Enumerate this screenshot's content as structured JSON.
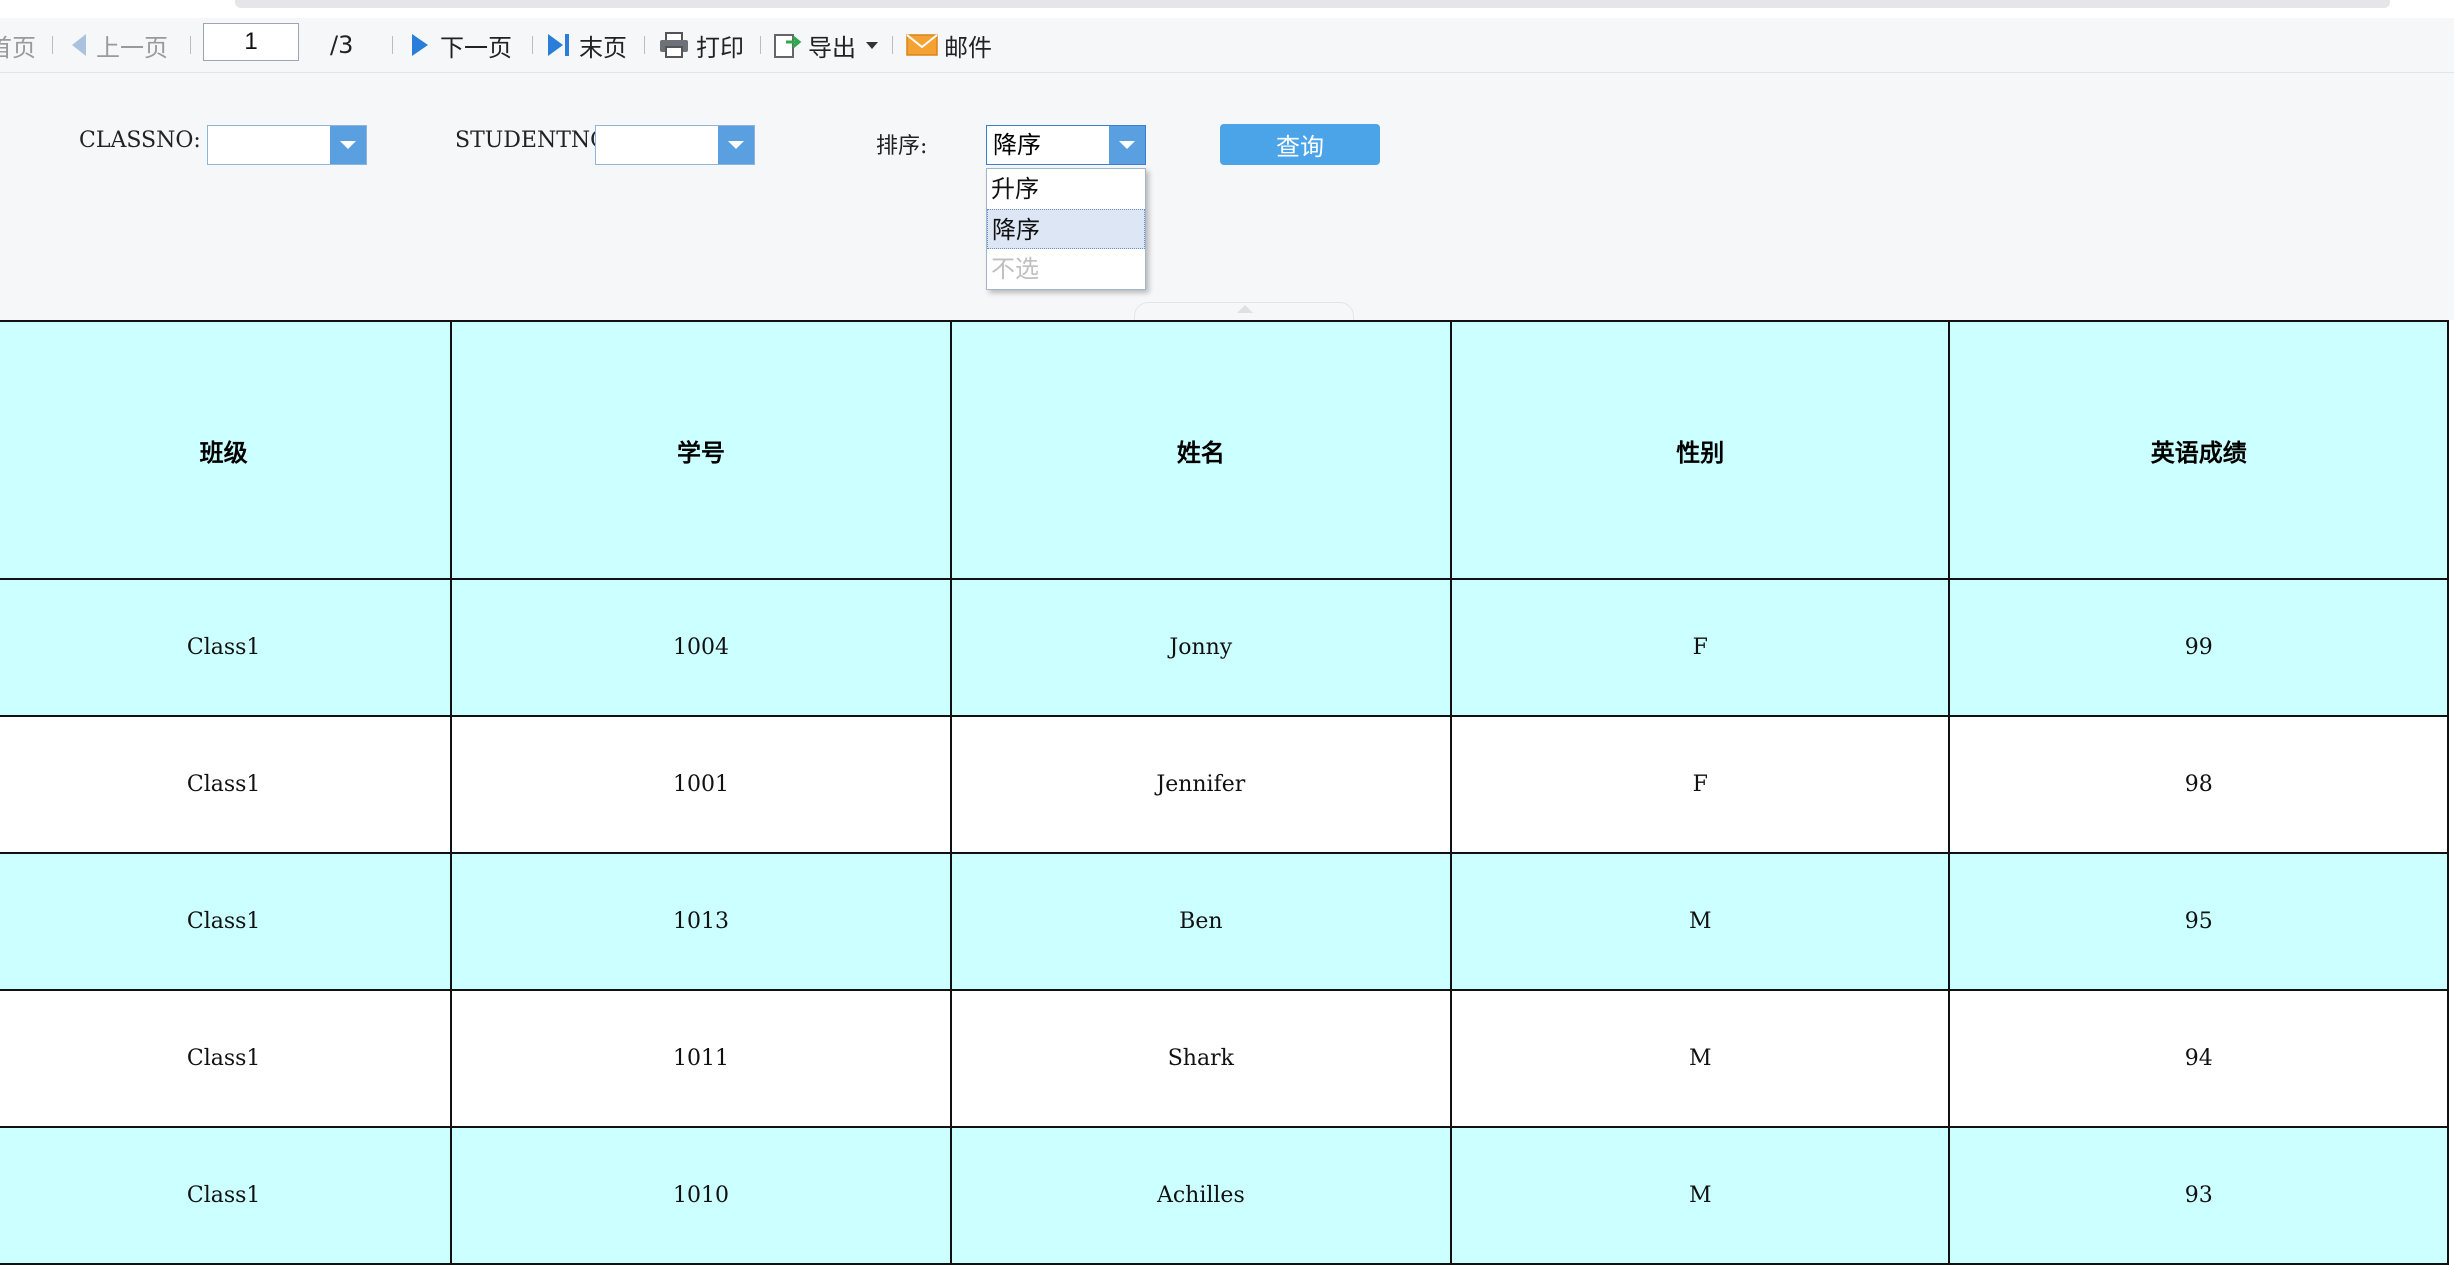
{
  "toolbar": {
    "first_label": "首页",
    "prev_label": "上一页",
    "page_input": "1",
    "total_pages": "/3",
    "next_label": "下一页",
    "last_label": "末页",
    "print_label": "打印",
    "export_label": "导出",
    "mail_label": "邮件"
  },
  "params": {
    "classno_label": "CLASSNO:",
    "classno_value": "",
    "studentno_label": "STUDENTNO:",
    "studentno_value": "",
    "sort_label": "排序:",
    "sort_value": "降序",
    "sort_options": [
      "升序",
      "降序",
      "不选"
    ],
    "sort_selected_index": 1,
    "query_label": "查询"
  },
  "table": {
    "headers": [
      "班级",
      "学号",
      "姓名",
      "性别",
      "英语成绩"
    ],
    "rows": [
      [
        "Class1",
        "1004",
        "Jonny",
        "F",
        "99"
      ],
      [
        "Class1",
        "1001",
        "Jennifer",
        "F",
        "98"
      ],
      [
        "Class1",
        "1013",
        "Ben",
        "M",
        "95"
      ],
      [
        "Class1",
        "1011",
        "Shark",
        "M",
        "94"
      ],
      [
        "Class1",
        "1010",
        "Achilles",
        "M",
        "93"
      ]
    ]
  },
  "colors": {
    "header_bg": "#ccffff",
    "row_alt_bg": "#ccffff",
    "accent_blue": "#4ba3e8"
  }
}
